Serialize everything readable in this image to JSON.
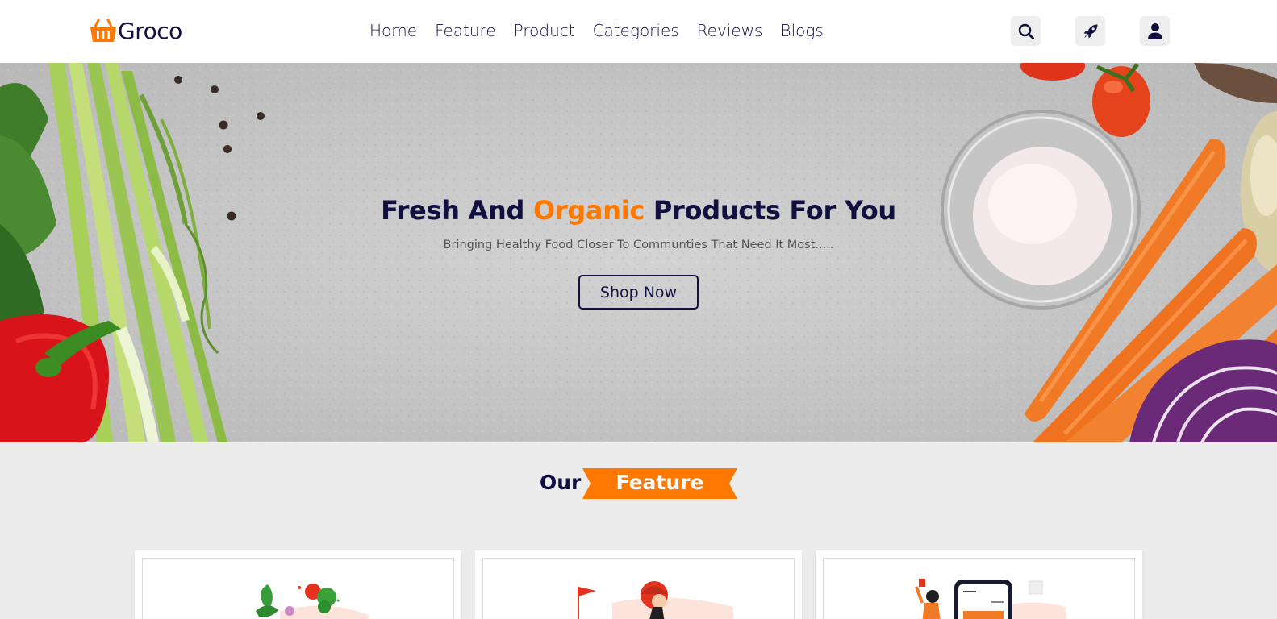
{
  "header": {
    "logo_text": "Groco",
    "nav": [
      "Home",
      "Feature",
      "Product",
      "Categories",
      "Reviews",
      "Blogs"
    ],
    "icons": [
      "search-icon",
      "rocket-icon",
      "user-icon"
    ]
  },
  "hero": {
    "title_part1": "Fresh And ",
    "title_accent": "Organic",
    "title_part2": " Products For You",
    "subtitle": "Bringing Healthy Food Closer To Communties That Need It Most.....",
    "button_label": "Shop Now"
  },
  "features": {
    "heading_plain": "Our",
    "heading_ribbon": "Feature"
  },
  "colors": {
    "accent": "#ff7800",
    "primary": "#130f40",
    "background": "#ececec"
  }
}
